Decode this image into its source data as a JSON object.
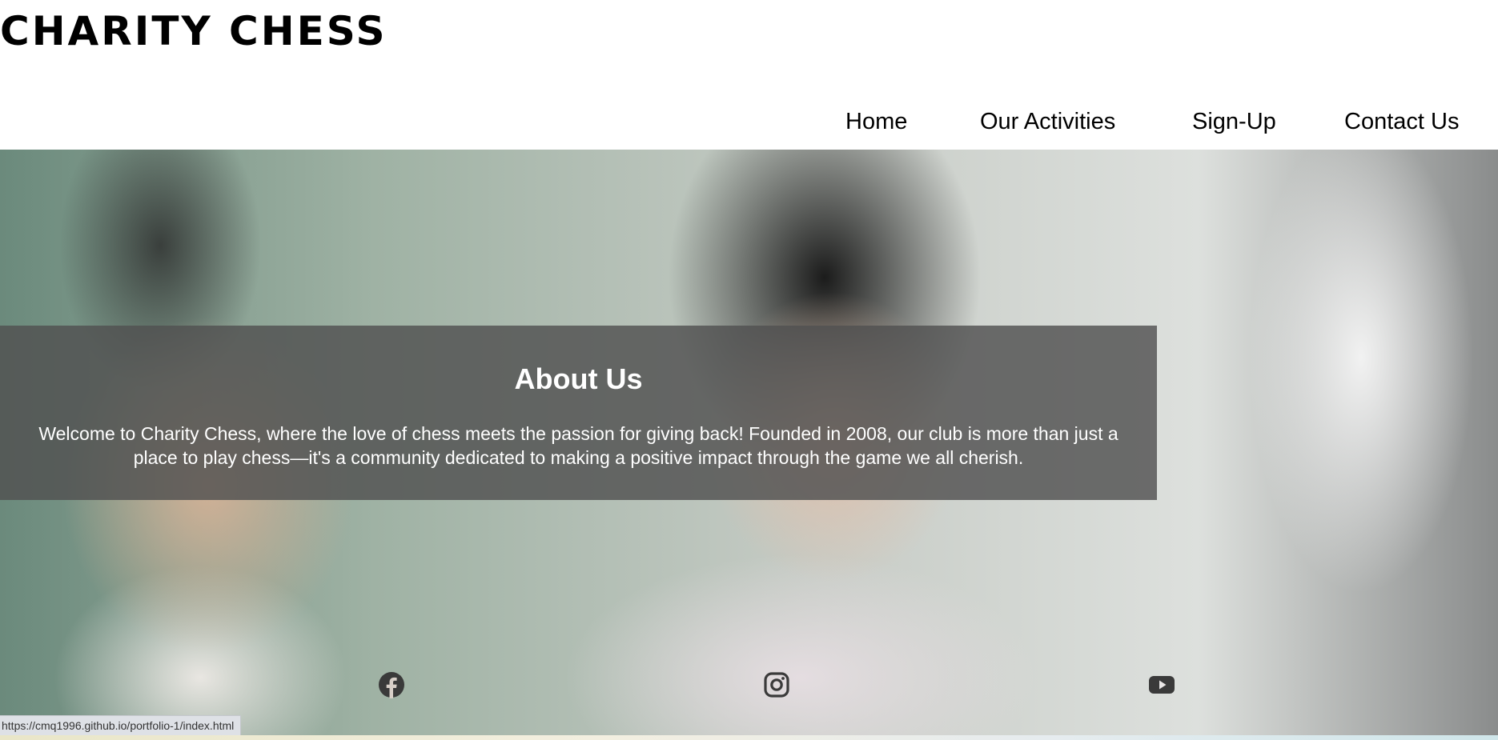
{
  "site": {
    "logo": "CHARITY CHESS"
  },
  "nav": {
    "items": [
      {
        "label": "Home"
      },
      {
        "label": "Our Activities"
      },
      {
        "label": "Sign-Up"
      },
      {
        "label": "Contact Us"
      }
    ]
  },
  "about": {
    "title": "About Us",
    "text": "Welcome to Charity Chess, where the love of chess meets the passion for giving back! Founded in 2008, our club is more than just a place to play chess—it's a community dedicated to making a positive impact through the game we all cherish."
  },
  "social": {
    "icons": [
      "facebook-icon",
      "instagram-icon",
      "youtube-icon"
    ],
    "color": "#3a3a3a"
  },
  "status_bar": {
    "url": "https://cmq1996.github.io/portfolio-1/index.html"
  }
}
